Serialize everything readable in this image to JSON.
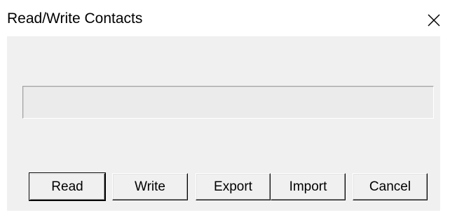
{
  "window": {
    "title": "Read/Write Contacts",
    "close_icon": "close-icon"
  },
  "progress": {
    "value": 0
  },
  "buttons": {
    "read": "Read",
    "write": "Write",
    "export": "Export",
    "import": "Import",
    "cancel": "Cancel"
  },
  "colors": {
    "dialog_face": "#f0f0f0",
    "title_bg": "#ffffff",
    "progress_fill": "#06b025"
  }
}
